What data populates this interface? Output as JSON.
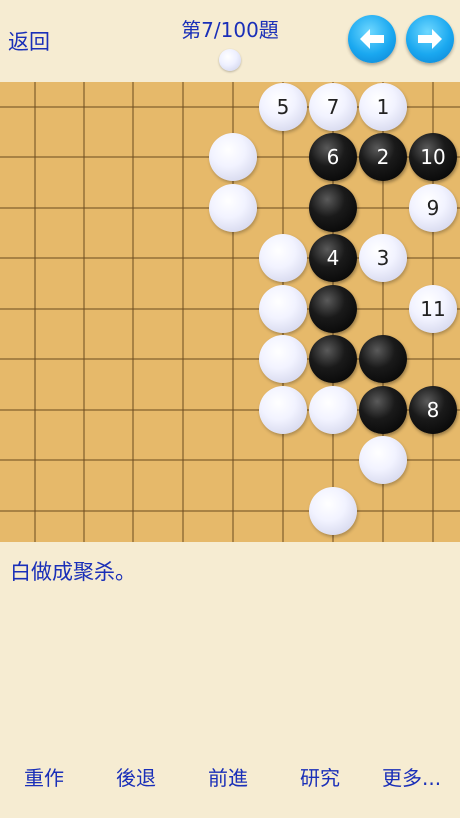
{
  "header": {
    "back_label": "返回",
    "title": "第7/100題"
  },
  "board": {
    "size": 9,
    "stones": [
      {
        "color": "white",
        "col": 5,
        "row": 0,
        "label": "5"
      },
      {
        "color": "white",
        "col": 6,
        "row": 0,
        "label": "7"
      },
      {
        "color": "white",
        "col": 7,
        "row": 0,
        "label": "1"
      },
      {
        "color": "white",
        "col": 4,
        "row": 1,
        "label": ""
      },
      {
        "color": "black",
        "col": 6,
        "row": 1,
        "label": "6"
      },
      {
        "color": "black",
        "col": 7,
        "row": 1,
        "label": "2"
      },
      {
        "color": "black",
        "col": 8,
        "row": 1,
        "label": "10"
      },
      {
        "color": "white",
        "col": 4,
        "row": 2,
        "label": ""
      },
      {
        "color": "black",
        "col": 6,
        "row": 2,
        "label": ""
      },
      {
        "color": "white",
        "col": 8,
        "row": 2,
        "label": "9"
      },
      {
        "color": "white",
        "col": 5,
        "row": 3,
        "label": ""
      },
      {
        "color": "black",
        "col": 6,
        "row": 3,
        "label": "4"
      },
      {
        "color": "white",
        "col": 7,
        "row": 3,
        "label": "3"
      },
      {
        "color": "white",
        "col": 5,
        "row": 4,
        "label": ""
      },
      {
        "color": "black",
        "col": 6,
        "row": 4,
        "label": ""
      },
      {
        "color": "white",
        "col": 8,
        "row": 4,
        "label": "11"
      },
      {
        "color": "white",
        "col": 5,
        "row": 5,
        "label": ""
      },
      {
        "color": "black",
        "col": 6,
        "row": 5,
        "label": ""
      },
      {
        "color": "black",
        "col": 7,
        "row": 5,
        "label": ""
      },
      {
        "color": "white",
        "col": 5,
        "row": 6,
        "label": ""
      },
      {
        "color": "white",
        "col": 6,
        "row": 6,
        "label": ""
      },
      {
        "color": "black",
        "col": 7,
        "row": 6,
        "label": ""
      },
      {
        "color": "black",
        "col": 8,
        "row": 6,
        "label": "8"
      },
      {
        "color": "white",
        "col": 7,
        "row": 7,
        "label": ""
      },
      {
        "color": "white",
        "col": 6,
        "row": 8,
        "label": ""
      }
    ]
  },
  "problem": {
    "text": "白做成聚杀。"
  },
  "toolbar": {
    "redo": "重作",
    "back": "後退",
    "forward": "前進",
    "study": "研究",
    "more": "更多..."
  }
}
